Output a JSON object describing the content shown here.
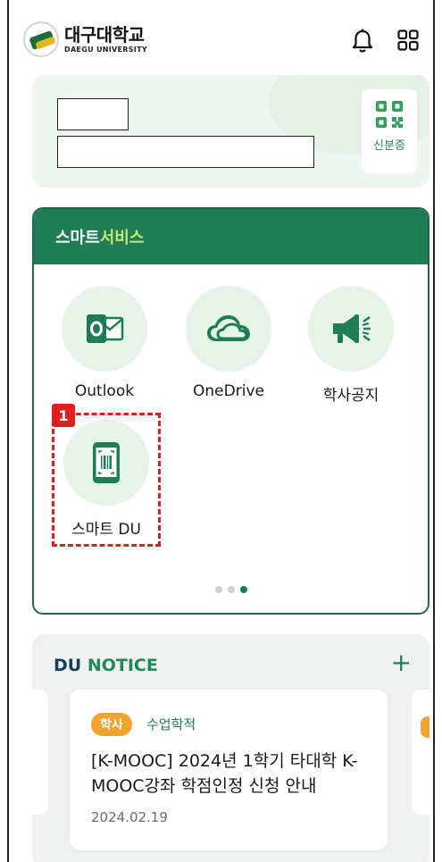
{
  "header": {
    "logo_ko": "대구대학교",
    "logo_en": "DAEGU UNIVERSITY",
    "bell_icon": "bell-icon",
    "menu_icon": "grid-menu-icon"
  },
  "id_card": {
    "qr_label": "신분증",
    "qr_icon": "qr-code-icon"
  },
  "smart_service": {
    "title_prefix": "스마트",
    "title_accent": "서비스",
    "items": [
      {
        "label": "Outlook",
        "icon": "outlook-icon"
      },
      {
        "label": "OneDrive",
        "icon": "cloud-icon"
      },
      {
        "label": "학사공지",
        "icon": "megaphone-icon"
      },
      {
        "label": "스마트 DU",
        "icon": "phone-barcode-icon"
      }
    ],
    "highlight_badge": "1",
    "page_indicator": {
      "total": 3,
      "active": 3
    }
  },
  "notice": {
    "title_prefix": "DU",
    "title_accent": "NOTICE",
    "more_label": "+",
    "card": {
      "tag": "학사",
      "category": "수업학적",
      "title": "[K-MOOC] 2024년 1학기 타대학 K-MOOC강좌 학점인정 신청 안내",
      "date": "2024.02.19"
    }
  },
  "colors": {
    "brand_green": "#1e7d57",
    "accent_lime": "#c6ea6e",
    "tag_orange": "#f0a32d",
    "highlight_red": "#e01f1f"
  }
}
